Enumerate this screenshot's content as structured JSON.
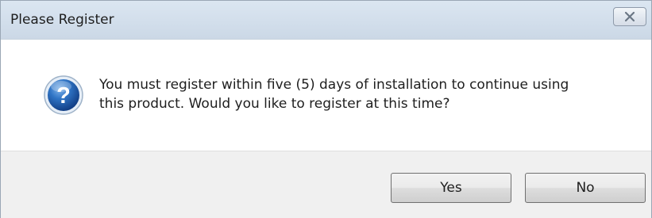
{
  "window": {
    "title": "Please Register",
    "close_icon": "close-icon"
  },
  "content": {
    "icon": "question-icon",
    "message_line1": "You must register within five (5) days of installation to continue using",
    "message_line2": "this product.  Would you like to register at this time?"
  },
  "buttons": {
    "yes_label": "Yes",
    "no_label": "No"
  },
  "colors": {
    "icon_blue": "#1f5fae",
    "titlebar": "#d6e1ed",
    "footer": "#f0f0f0"
  }
}
